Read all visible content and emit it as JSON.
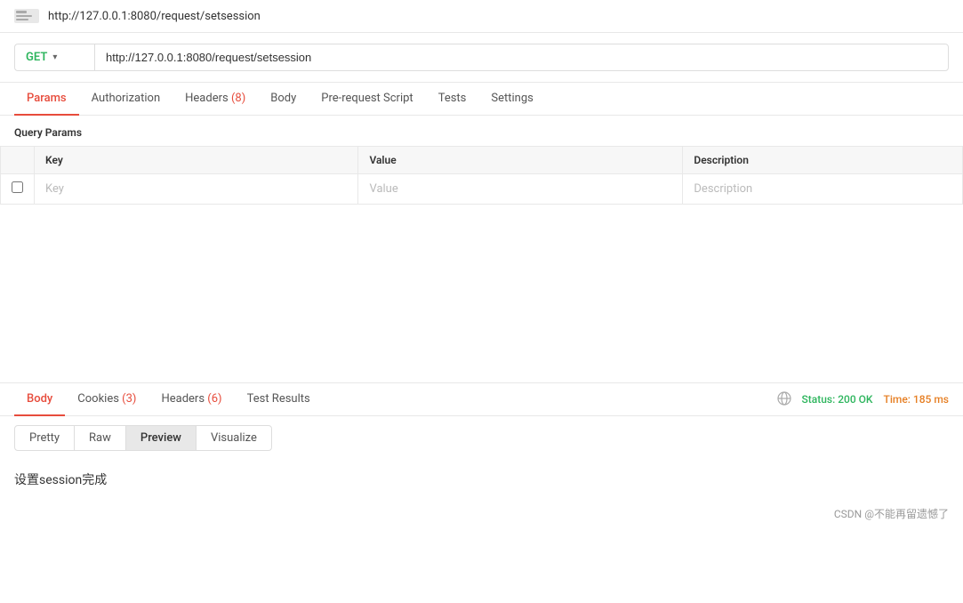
{
  "titleBar": {
    "url": "http://127.0.0.1:8080/request/setsession",
    "iconAlt": "postman-icon"
  },
  "urlBar": {
    "method": "GET",
    "chevron": "▾",
    "url": "http://127.0.0.1:8080/request/setsession"
  },
  "requestTabs": [
    {
      "id": "params",
      "label": "Params",
      "active": true,
      "badge": ""
    },
    {
      "id": "authorization",
      "label": "Authorization",
      "active": false,
      "badge": ""
    },
    {
      "id": "headers",
      "label": "Headers",
      "active": false,
      "badge": "(8)"
    },
    {
      "id": "body",
      "label": "Body",
      "active": false,
      "badge": ""
    },
    {
      "id": "prerequest",
      "label": "Pre-request Script",
      "active": false,
      "badge": ""
    },
    {
      "id": "tests",
      "label": "Tests",
      "active": false,
      "badge": ""
    },
    {
      "id": "settings",
      "label": "Settings",
      "active": false,
      "badge": ""
    }
  ],
  "queryParams": {
    "sectionTitle": "Query Params",
    "columns": [
      "Key",
      "Value",
      "Description"
    ],
    "placeholder": {
      "key": "Key",
      "value": "Value",
      "description": "Description"
    }
  },
  "responseTabs": [
    {
      "id": "body",
      "label": "Body",
      "active": true,
      "badge": ""
    },
    {
      "id": "cookies",
      "label": "Cookies",
      "active": false,
      "badge": "(3)"
    },
    {
      "id": "headers",
      "label": "Headers",
      "active": false,
      "badge": "(6)"
    },
    {
      "id": "testresults",
      "label": "Test Results",
      "active": false,
      "badge": ""
    }
  ],
  "responseStatus": {
    "status": "Status: 200 OK",
    "time": "Time: 185 ms"
  },
  "formatTabs": [
    {
      "id": "pretty",
      "label": "Pretty",
      "active": false
    },
    {
      "id": "raw",
      "label": "Raw",
      "active": false
    },
    {
      "id": "preview",
      "label": "Preview",
      "active": true
    },
    {
      "id": "visualize",
      "label": "Visualize",
      "active": false
    }
  ],
  "responseBody": "设置session完成",
  "footer": {
    "text": "CSDN @不能再留遗憾了"
  }
}
